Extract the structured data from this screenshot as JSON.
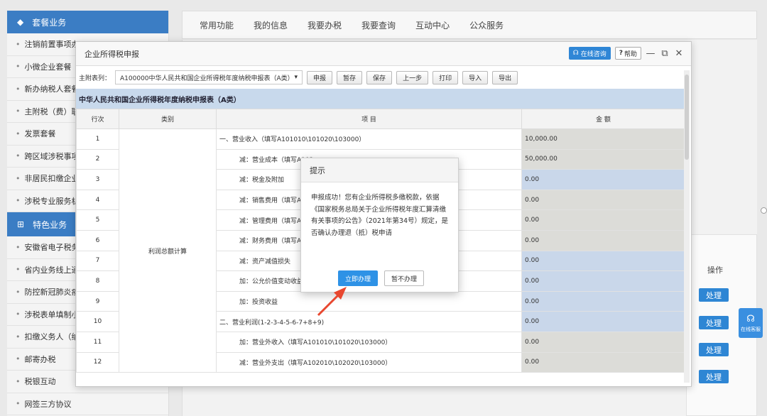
{
  "sidebar": {
    "section1": "套餐业务",
    "items1": [
      "注销前置事项办",
      "小微企业套餐",
      "新办纳税人套餐",
      "主附税（费）联",
      "发票套餐",
      "跨区域涉税事项",
      "非居民扣缴企业",
      "涉税专业服务机"
    ],
    "section2": "特色业务",
    "items2": [
      "安徽省电子税务",
      "省内业务线上通",
      "防控新冠肺炎疫",
      "涉税表单填制小",
      "扣缴义务人（纳",
      "邮寄办税",
      "税银互动",
      "网签三方协议"
    ]
  },
  "topnav": [
    "常用功能",
    "我的信息",
    "我要办税",
    "我要查询",
    "互动中心",
    "公众服务"
  ],
  "background": {
    "op_title": "操作",
    "process_label": "处理",
    "float_service": "在线客服"
  },
  "dialog": {
    "title": "企业所得税申报",
    "online_consult": "在线咨询",
    "help": "帮助",
    "table_label": "主附表列：",
    "table_select": "A100000中华人民共和国企业所得税年度纳税申报表（A类）",
    "buttons": [
      "申报",
      "暂存",
      "保存",
      "上一步",
      "打印",
      "导入",
      "导出"
    ],
    "form_title": "中华人民共和国企业所得税年度纳税申报表（A类）",
    "headers": [
      "行次",
      "类别",
      "项 目",
      "金 额"
    ],
    "category": "利润总额计算",
    "rows": [
      {
        "no": "1",
        "item": "一、营业收入（填写A101010\\101020\\103000）",
        "amount": "10,000.00",
        "indent": false,
        "blue": false
      },
      {
        "no": "2",
        "item": "减：营业成本（填写A102",
        "amount": "50,000.00",
        "indent": true,
        "blue": false
      },
      {
        "no": "3",
        "item": "减：税金及附加",
        "amount": "0.00",
        "indent": true,
        "blue": true
      },
      {
        "no": "4",
        "item": "减：销售费用（填写A104",
        "amount": "0.00",
        "indent": true,
        "blue": false
      },
      {
        "no": "5",
        "item": "减：管理费用（填写A104",
        "amount": "0.00",
        "indent": true,
        "blue": false
      },
      {
        "no": "6",
        "item": "减：财务费用（填写A104",
        "amount": "0.00",
        "indent": true,
        "blue": false
      },
      {
        "no": "7",
        "item": "减：资产减值损失",
        "amount": "0.00",
        "indent": true,
        "blue": true
      },
      {
        "no": "8",
        "item": "加：公允价值变动收益",
        "amount": "0.00",
        "indent": true,
        "blue": true
      },
      {
        "no": "9",
        "item": "加：投资收益",
        "amount": "0.00",
        "indent": true,
        "blue": true
      },
      {
        "no": "10",
        "item": "二、营业利润(1-2-3-4-5-6-7+8+9)",
        "amount": "0.00",
        "indent": false,
        "blue": true
      },
      {
        "no": "11",
        "item": "加：营业外收入（填写A101010\\101020\\103000）",
        "amount": "0.00",
        "indent": true,
        "blue": false
      },
      {
        "no": "12",
        "item": "减：营业外支出（填写A102010\\102020\\103000）",
        "amount": "0.00",
        "indent": true,
        "blue": false
      }
    ]
  },
  "prompt": {
    "title": "提示",
    "message": "申报成功！您有企业所得税多缴税款，依据《国家税务总局关于企业所得税年度汇算清缴有关事项的公告》（2021年第34号）规定，是否确认办理退（抵）税申请",
    "confirm": "立即办理",
    "cancel": "暂不办理"
  },
  "colors": {
    "accent": "#2e86d4",
    "header_blue": "#3b7dc4",
    "arrow": "#e8472f"
  }
}
